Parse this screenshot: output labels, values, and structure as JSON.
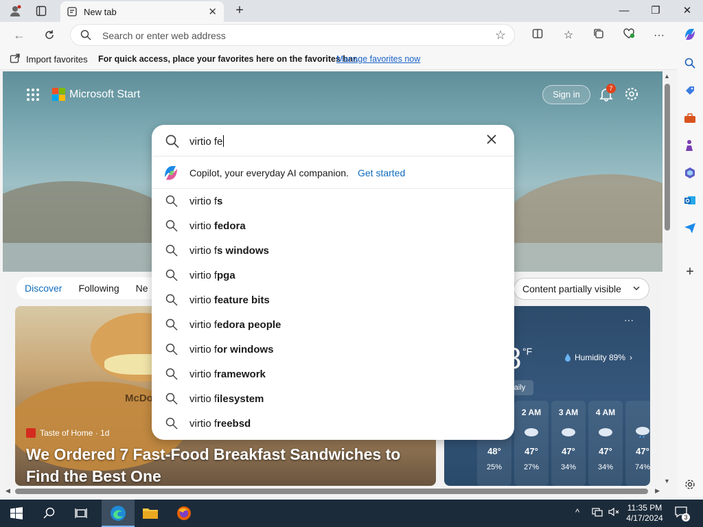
{
  "browser": {
    "tab_title": "New tab",
    "address_placeholder": "Search or enter web address"
  },
  "favorites_bar": {
    "import_label": "Import favorites",
    "hint": "For quick access, place your favorites here on the favorites bar.",
    "manage_link": "Manage favorites now"
  },
  "start_page": {
    "brand": "Microsoft Start",
    "sign_in": "Sign in",
    "notification_count": "7",
    "tabs": [
      "Discover",
      "Following",
      "Ne"
    ],
    "active_tab": "Discover",
    "content_visibility": "Content partially visible"
  },
  "search": {
    "query": "virtio fe",
    "copilot_text": "Copilot, your everyday AI companion.",
    "copilot_link": "Get started",
    "suggestions": [
      {
        "prefix": "virtio f",
        "rest": "s"
      },
      {
        "prefix": "virtio ",
        "rest": "fedora"
      },
      {
        "prefix": "virtio f",
        "rest": "s windows"
      },
      {
        "prefix": "virtio f",
        "rest": "pga"
      },
      {
        "prefix": "virtio ",
        "rest": "feature bits"
      },
      {
        "prefix": "virtio f",
        "rest": "edora people"
      },
      {
        "prefix": "virtio f",
        "rest": "or windows"
      },
      {
        "prefix": "virtio f",
        "rest": "ramework"
      },
      {
        "prefix": "virtio f",
        "rest": "ilesystem"
      },
      {
        "prefix": "virtio f",
        "rest": "reebsd"
      }
    ]
  },
  "news_card": {
    "source": "Taste of Home · 1d",
    "headline": "We Ordered 7 Fast-Food Breakfast Sandwiches to Find the Best One",
    "image_text": "McDona"
  },
  "weather_card": {
    "temp_partial": "8",
    "unit": "°F",
    "humidity": "Humidity 89%",
    "daily_label": "aily",
    "hours": [
      {
        "time": "M",
        "temp": "48°",
        "precip": "25%"
      },
      {
        "time": "2 AM",
        "temp": "47°",
        "precip": "27%"
      },
      {
        "time": "3 AM",
        "temp": "47°",
        "precip": "34%"
      },
      {
        "time": "4 AM",
        "temp": "47°",
        "precip": "34%"
      },
      {
        "time": "",
        "temp": "47°",
        "precip": "74%"
      }
    ],
    "hour_labels_visible": [
      "M",
      "2 AM",
      "3 AM",
      "4 AM"
    ]
  },
  "taskbar": {
    "time": "11:35 PM",
    "date": "4/17/2024",
    "notification_count": "3"
  },
  "colors": {
    "accent": "#0f6cbd",
    "badge": "#e0441c",
    "taskbar": "#1c2b3a"
  }
}
